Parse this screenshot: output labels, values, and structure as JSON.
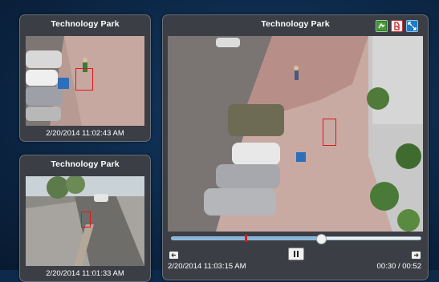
{
  "cameras": [
    {
      "title": "Technology Park",
      "timestamp": "2/20/2014 11:02:43 AM"
    },
    {
      "title": "Technology Park",
      "timestamp": "2/20/2014 11:01:33 AM"
    }
  ],
  "main_player": {
    "title": "Technology Park",
    "timestamp": "2/20/2014 11:03:15 AM",
    "time_display": "00:30 / 00:52",
    "progress": 0.595,
    "marker_position": 0.295,
    "buttons": {
      "export_icon": "map-export-icon",
      "pdf_icon": "pdf-report-icon",
      "expand_icon": "expand-icon",
      "prev_icon": "step-back-icon",
      "pause_icon": "pause-icon",
      "next_icon": "step-forward-icon"
    },
    "colors": {
      "track": "#7fb7e6",
      "marker": "#e01818",
      "panel": "#3b3f45",
      "background": "#0d2a4a"
    }
  }
}
